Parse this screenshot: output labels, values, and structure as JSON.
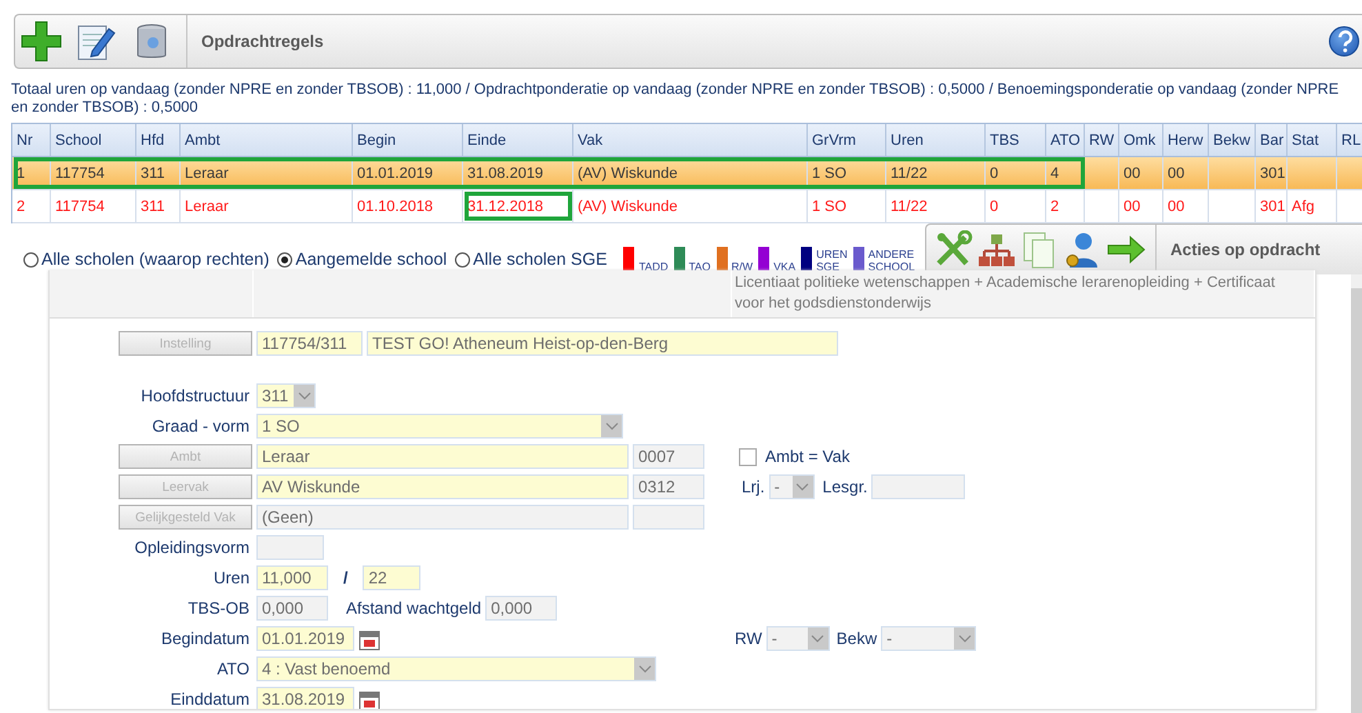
{
  "toolbar": {
    "title": "Opdrachtregels"
  },
  "summary": "Totaal uren op vandaag (zonder NPRE en zonder TBSOB) : 11,000 / Opdrachtponderatie op vandaag (zonder NPRE en zonder TBSOB) : 0,5000 / Benoemingsponderatie op vandaag (zonder NPRE en zonder TBSOB) : 0,5000",
  "table": {
    "columns": [
      "Nr",
      "School",
      "Hfd",
      "Ambt",
      "Begin",
      "Einde",
      "Vak",
      "GrVrm",
      "Uren",
      "TBS",
      "ATO",
      "RW",
      "Omk",
      "Herw",
      "Bekw",
      "Bar",
      "Stat",
      "RL"
    ],
    "rows": [
      {
        "selected": true,
        "color": "#3a3a3a",
        "outlined": true,
        "einde_outlined": false,
        "cells": [
          "1",
          "117754",
          "311",
          "Leraar",
          "01.01.2019",
          "31.08.2019",
          "(AV) Wiskunde",
          "1 SO",
          "11/22",
          "0",
          "4",
          null,
          "00",
          "00",
          null,
          "301",
          null,
          null
        ]
      },
      {
        "selected": false,
        "color": "#ff1a1a",
        "outlined": false,
        "einde_outlined": true,
        "cells": [
          "2",
          "117754",
          "311",
          "Leraar",
          "01.10.2018",
          "31.12.2018",
          "(AV) Wiskunde",
          "1 SO",
          "11/22",
          "0",
          "2",
          null,
          "00",
          "00",
          null,
          "301",
          "Afg",
          null
        ]
      }
    ]
  },
  "school_filter": [
    {
      "label": "Alle scholen (waarop rechten)",
      "selected": false
    },
    {
      "label": "Aangemelde school",
      "selected": true
    },
    {
      "label": "Alle scholen SGE",
      "selected": false
    }
  ],
  "legend": [
    {
      "label": "TADD",
      "color": "#ff0000"
    },
    {
      "label": "TAO",
      "color": "#2e8b57"
    },
    {
      "label": "R/W",
      "color": "#e07020"
    },
    {
      "label": "VKA",
      "color": "#9400d3"
    },
    {
      "label": "UREN SGE",
      "color": "#000080"
    },
    {
      "label": "ANDERE SCHOOL",
      "color": "#6a5acd"
    }
  ],
  "actions_toolbar": {
    "title": "Acties op opdracht"
  },
  "info_text": "Licentiaat politieke wetenschappen + Academische lerarenopleiding + Certificaat voor het godsdienstonderwijs",
  "form": {
    "instelling": {
      "button": "Instelling",
      "disabled": true,
      "code": "117754/311",
      "name": "TEST GO! Atheneum Heist-op-den-Berg"
    },
    "hoofdstructuur": {
      "label": "Hoofdstructuur",
      "value": "311"
    },
    "graad_vorm": {
      "label": "Graad - vorm",
      "value": "1 SO"
    },
    "ambt": {
      "button": "Ambt",
      "disabled": true,
      "value": "Leraar",
      "code": "0007"
    },
    "ambt_is_vak": {
      "label": "Ambt = Vak",
      "checked": false
    },
    "leervak": {
      "button": "Leervak",
      "disabled": true,
      "value": "AV Wiskunde",
      "code": "0312"
    },
    "lrj": {
      "label": "Lrj.",
      "value": "-"
    },
    "lesgr": {
      "label": "Lesgr."
    },
    "gelijkgesteld_vak": {
      "button": "Gelijkgesteld Vak",
      "disabled": true,
      "value": "(Geen)"
    },
    "opleidingsvorm": {
      "label": "Opleidingsvorm"
    },
    "uren": {
      "label": "Uren",
      "value": "11,000",
      "separator": "/",
      "total": "22"
    },
    "tbs_ob": {
      "label": "TBS-OB",
      "value": "0,000"
    },
    "afstand_wachtgeld": {
      "label": "Afstand wachtgeld",
      "value": "0,000"
    },
    "begindatum": {
      "label": "Begindatum",
      "value": "01.01.2019"
    },
    "rw": {
      "label": "RW",
      "value": "-"
    },
    "bekw": {
      "label": "Bekw",
      "value": "-"
    },
    "ato": {
      "label": "ATO",
      "value": "4 : Vast benoemd"
    },
    "einddatum": {
      "label": "Einddatum",
      "value": "31.08.2019"
    }
  }
}
